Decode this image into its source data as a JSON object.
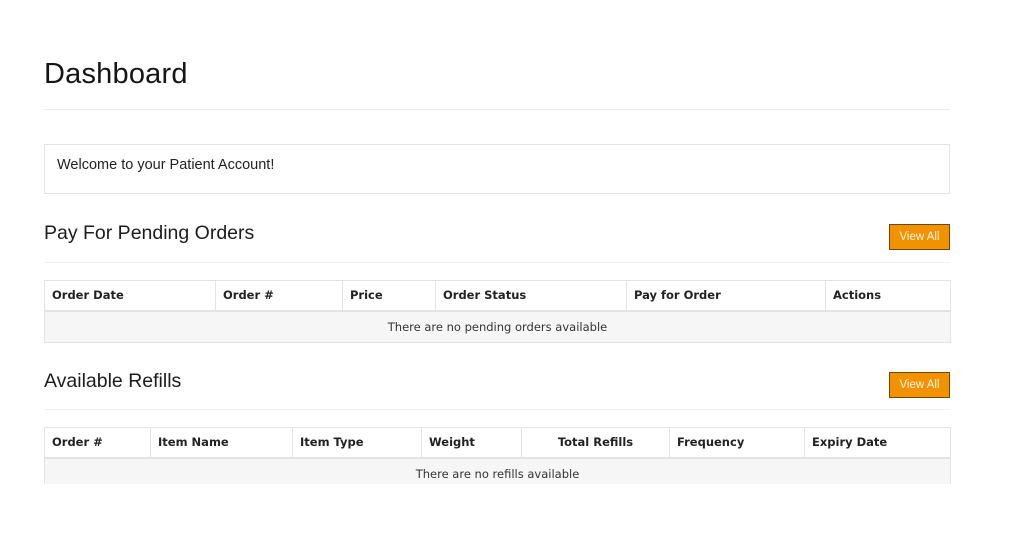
{
  "page": {
    "title": "Dashboard",
    "welcome_message": "Welcome to your Patient Account!"
  },
  "pending_orders": {
    "title": "Pay For Pending Orders",
    "view_all_label": "View All",
    "columns": [
      "Order Date",
      "Order #",
      "Price",
      "Order Status",
      "Pay for Order",
      "Actions"
    ],
    "empty_message": "There are no pending orders available"
  },
  "refills": {
    "title": "Available Refills",
    "view_all_label": "View All",
    "columns": [
      "Order #",
      "Item Name",
      "Item Type",
      "Weight",
      "Total Refills",
      "Frequency",
      "Expiry Date"
    ],
    "empty_message": "There are no refills available"
  },
  "colors": {
    "button_accent": "#f39200"
  }
}
